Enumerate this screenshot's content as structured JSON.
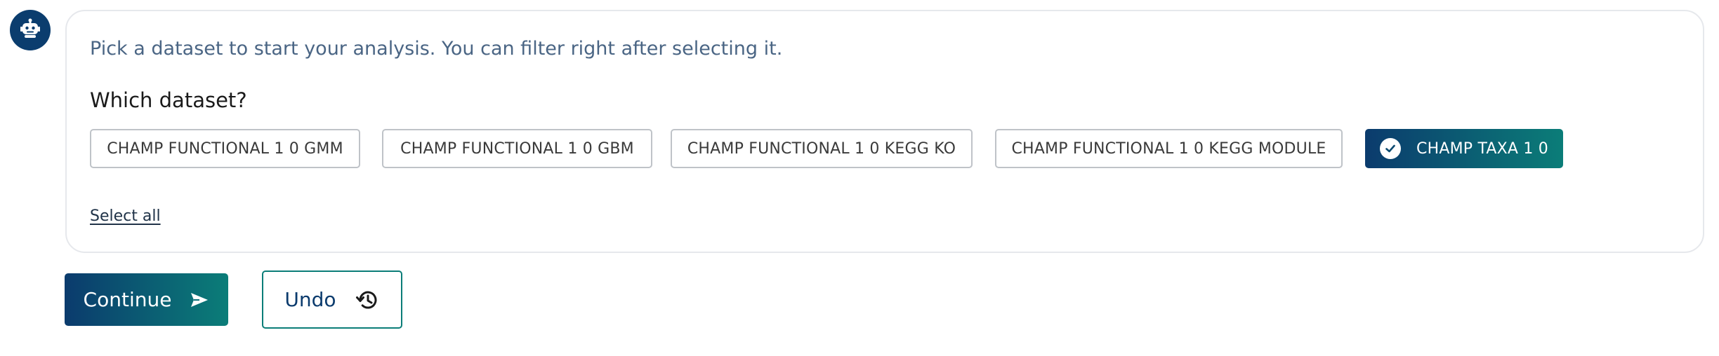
{
  "assistant": {
    "avatar_icon": "robot-icon"
  },
  "message": {
    "intro": "Pick a dataset to start your analysis. You can filter right after selecting it.",
    "question": "Which dataset?",
    "options": [
      {
        "label": "CHAMP FUNCTIONAL 1 0 GMM",
        "selected": false
      },
      {
        "label": "CHAMP FUNCTIONAL 1 0 GBM",
        "selected": false
      },
      {
        "label": "CHAMP FUNCTIONAL 1 0 KEGG KO",
        "selected": false
      },
      {
        "label": "CHAMP FUNCTIONAL 1 0 KEGG MODULE",
        "selected": false
      },
      {
        "label": "CHAMP TAXA 1 0",
        "selected": true
      }
    ],
    "select_all_label": "Select all"
  },
  "actions": {
    "continue_label": "Continue",
    "continue_icon": "send-icon",
    "undo_label": "Undo",
    "undo_icon": "history-icon"
  },
  "colors": {
    "brand_dark": "#0b3b6d",
    "brand_teal": "#0b7d78",
    "intro_text": "#4a6584"
  }
}
